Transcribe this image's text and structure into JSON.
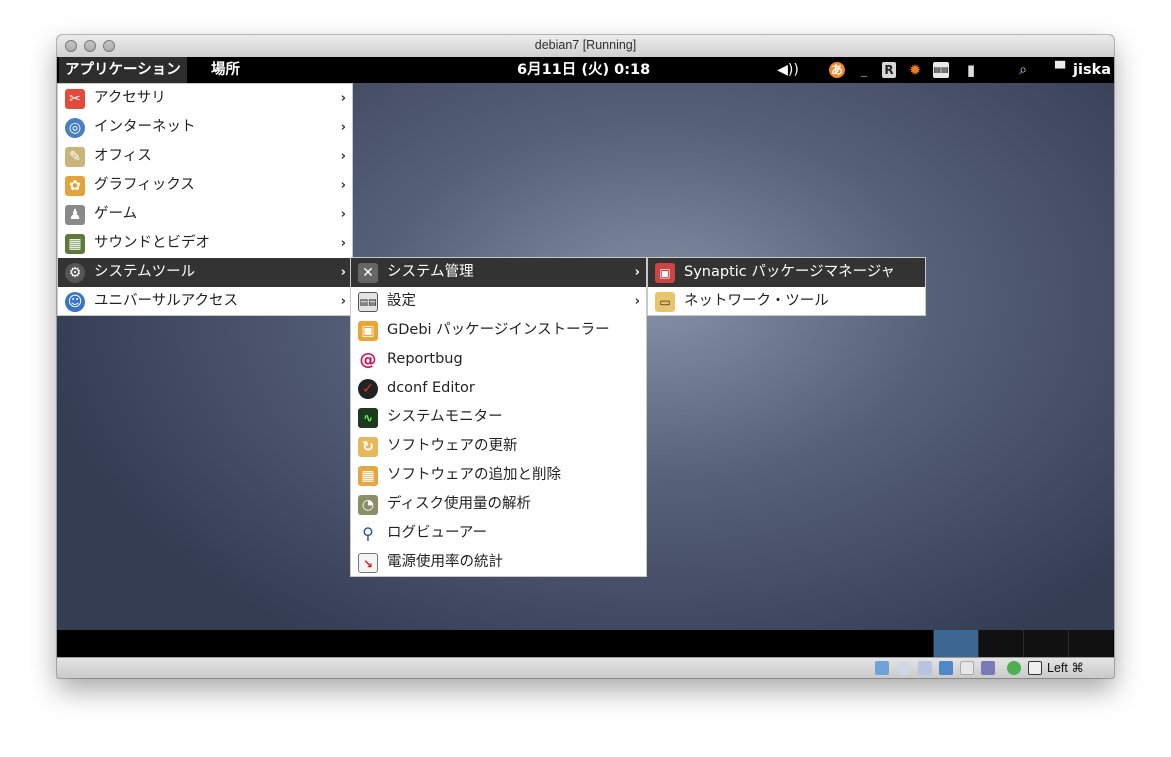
{
  "window": {
    "title": "debian7 [Running]"
  },
  "topbar": {
    "applications": "アプリケーション",
    "places": "場所",
    "clock": "6月11日 (火) 0:18",
    "user": "jiska"
  },
  "menus": {
    "main": [
      {
        "label": "アクセサリ",
        "icon": "accessories-icon",
        "submenu": true
      },
      {
        "label": "インターネット",
        "icon": "internet-globe-icon",
        "submenu": true
      },
      {
        "label": "オフィス",
        "icon": "office-icon",
        "submenu": true
      },
      {
        "label": "グラフィックス",
        "icon": "graphics-palette-icon",
        "submenu": true
      },
      {
        "label": "ゲーム",
        "icon": "games-joystick-icon",
        "submenu": true
      },
      {
        "label": "サウンドとビデオ",
        "icon": "sound-video-film-icon",
        "submenu": true
      },
      {
        "label": "システムツール",
        "icon": "system-gear-icon",
        "submenu": true,
        "highlighted": true
      },
      {
        "label": "ユニバーサルアクセス",
        "icon": "accessibility-icon",
        "submenu": true
      }
    ],
    "system_tools": [
      {
        "label": "システム管理",
        "icon": "tools-icon",
        "submenu": true,
        "highlighted": true
      },
      {
        "label": "設定",
        "icon": "preferences-icon",
        "submenu": true
      },
      {
        "label": "GDebi パッケージインストーラー",
        "icon": "package-installer-icon"
      },
      {
        "label": "Reportbug",
        "icon": "debian-swirl-icon"
      },
      {
        "label": "dconf Editor",
        "icon": "dconf-editor-icon"
      },
      {
        "label": "システムモニター",
        "icon": "system-monitor-icon"
      },
      {
        "label": "ソフトウェアの更新",
        "icon": "software-update-icon"
      },
      {
        "label": "ソフトウェアの追加と削除",
        "icon": "software-add-remove-icon"
      },
      {
        "label": "ディスク使用量の解析",
        "icon": "disk-usage-icon"
      },
      {
        "label": "ログビューアー",
        "icon": "log-viewer-icon"
      },
      {
        "label": "電源使用率の統計",
        "icon": "power-statistics-icon"
      }
    ],
    "administration": [
      {
        "label": "Synaptic パッケージマネージャ",
        "icon": "synaptic-icon",
        "highlighted": true
      },
      {
        "label": "ネットワーク・ツール",
        "icon": "network-tools-icon"
      }
    ]
  },
  "statusbar": {
    "host_key": "Left ⌘"
  }
}
